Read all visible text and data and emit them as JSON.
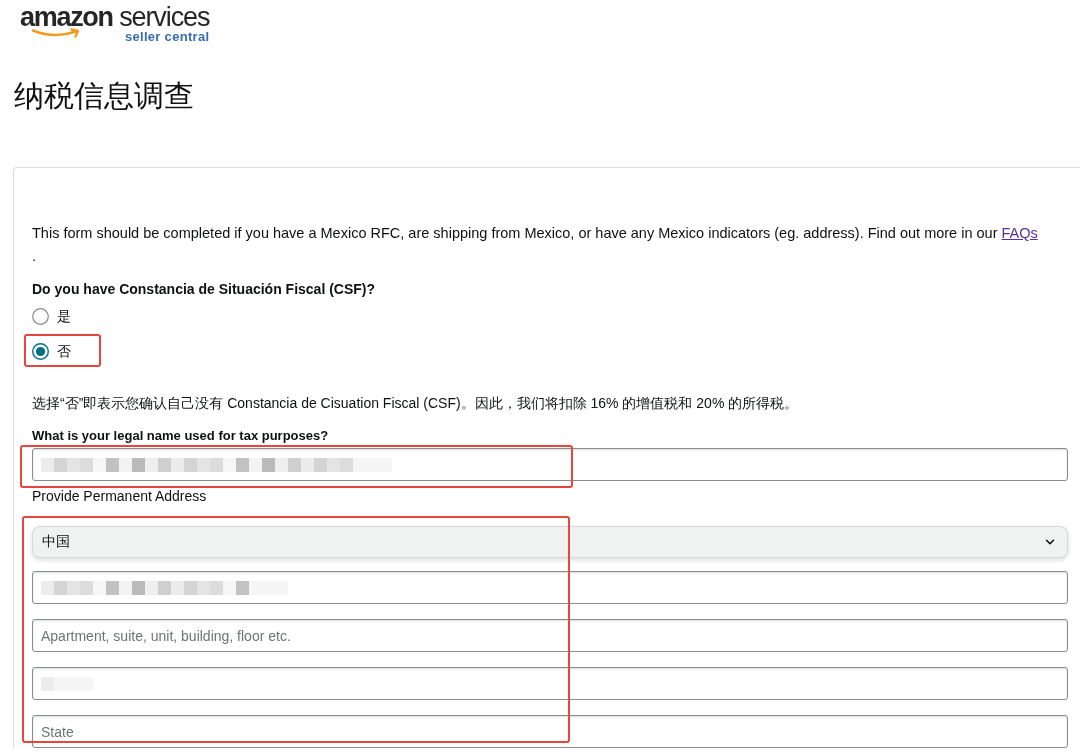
{
  "logo": {
    "wordmark": "**amazon** services",
    "tagline": "seller central"
  },
  "page_title": "纳税信息调查",
  "form": {
    "intro": {
      "text": "This form should be completed if you have a Mexico RFC, are shipping from Mexico, or have any Mexico indicators (eg. address). Find out more in our",
      "link": "FAQs",
      "trailing": "."
    },
    "csf_question": {
      "label": "Do you have Constancia de Situación Fiscal (CSF)?",
      "options": [
        {
          "label": "是",
          "selected": false,
          "highlighted": false
        },
        {
          "label": "否",
          "selected": true,
          "highlighted": true
        }
      ]
    },
    "notice": "选择“否”即表示您确认自己没有 Constancia de Cisuation Fiscal (CSF)。因此，我们将扣除 16% 的增值税和 20% 的所得税。",
    "legal_name": {
      "label": "What is your legal name used for tax purposes?",
      "redacted": true,
      "highlighted": true
    },
    "address": {
      "label": "Provide Permanent Address",
      "highlighted": true,
      "country": {
        "value": "中国"
      },
      "fields": [
        {
          "redacted": true
        },
        {
          "placeholder": "Apartment, suite, unit, building, floor etc.",
          "redacted": false
        },
        {
          "redacted": true
        },
        {
          "placeholder": "State",
          "redacted": false
        }
      ]
    }
  }
}
